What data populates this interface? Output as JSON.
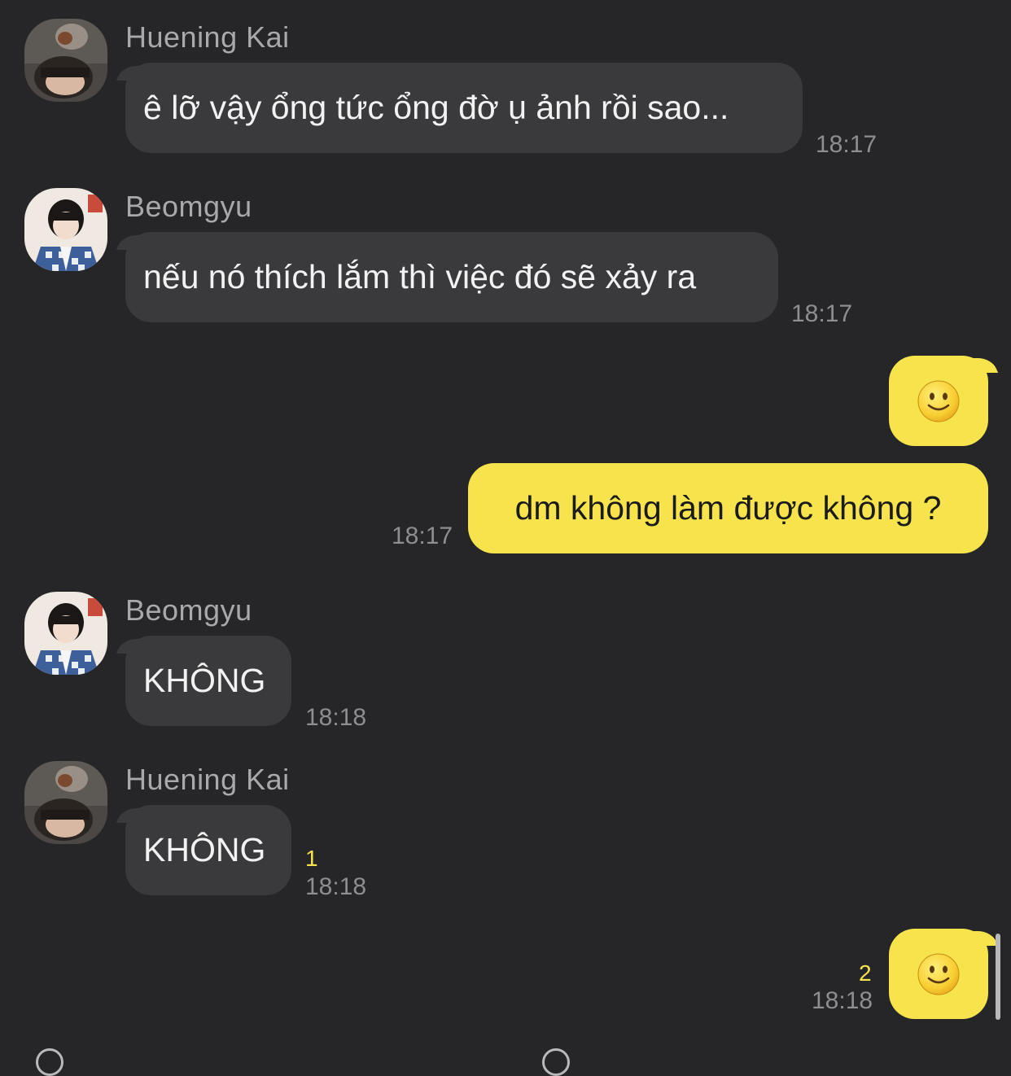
{
  "messages": [
    {
      "sender": "Huening Kai",
      "avatar_icon": "huening-kai-avatar",
      "text": "ê lỡ vậy ổng tức ổng đờ ụ ảnh rồi sao...",
      "time": "18:17"
    },
    {
      "sender": "Beomgyu",
      "avatar_icon": "beomgyu-avatar",
      "text": "nếu nó thích lắm thì việc đó sẽ xảy ra",
      "time": "18:17"
    },
    {
      "sender": "me",
      "emoji": "slightly-smiling-face-emoji"
    },
    {
      "sender": "me",
      "text": "dm không làm được không ?",
      "time": "18:17"
    },
    {
      "sender": "Beomgyu",
      "avatar_icon": "beomgyu-avatar",
      "text": "KHÔNG",
      "time": "18:18"
    },
    {
      "sender": "Huening Kai",
      "avatar_icon": "huening-kai-avatar",
      "text": "KHÔNG",
      "unread": "1",
      "time": "18:18"
    },
    {
      "sender": "me",
      "emoji": "slightly-smiling-face-emoji",
      "unread": "2",
      "time": "18:18"
    }
  ],
  "colors": {
    "background": "#262628",
    "incoming_bubble": "#3a3a3c",
    "outgoing_bubble": "#f7e44d",
    "unread_count": "#f7e44d"
  }
}
